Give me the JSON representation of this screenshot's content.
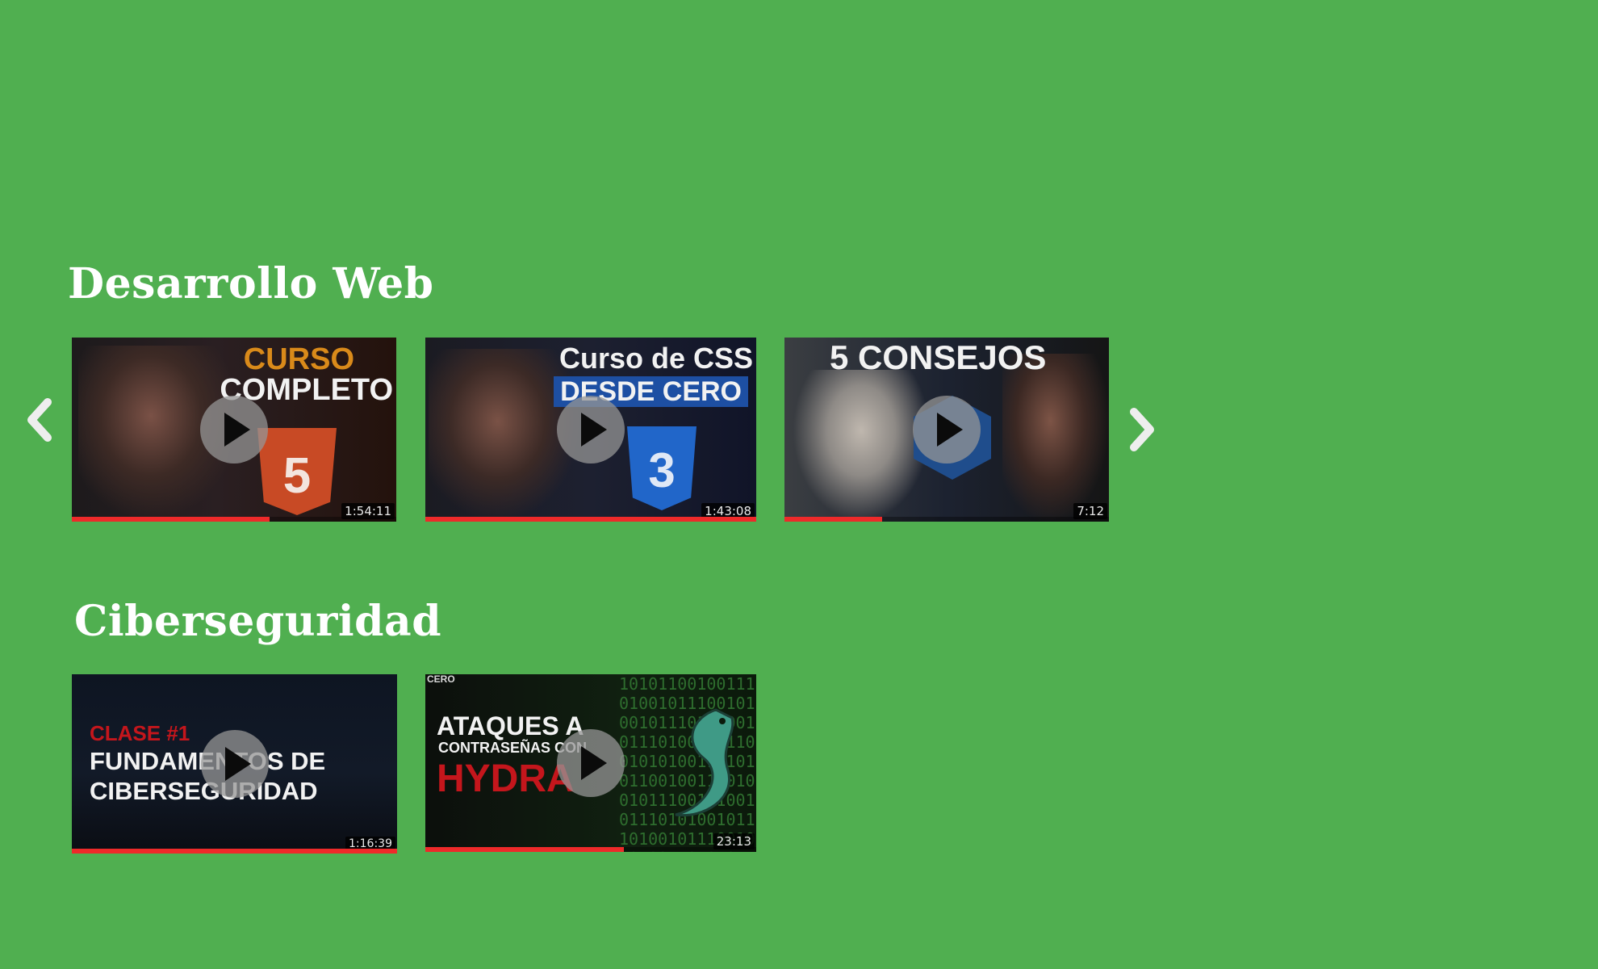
{
  "sections": [
    {
      "title": "Desarrollo Web",
      "videos": [
        {
          "line1": "CURSO",
          "line2": "COMPLETO",
          "duration": "1:54:11",
          "progress": 0.61,
          "icon": "html5-logo-icon"
        },
        {
          "line1": "Curso de CSS",
          "line2": "DESDE CERO",
          "duration": "1:43:08",
          "progress": 1.0,
          "icon": "css3-logo-icon"
        },
        {
          "line1": "5 CONSEJOS",
          "duration": "7:12",
          "progress": 0.3,
          "icon": "cpp-logo-icon"
        }
      ]
    },
    {
      "title": "Ciberseguridad",
      "videos": [
        {
          "line1": "CLASE #1",
          "line2": "FUNDAMENTOS DE",
          "line3": "CIBERSEGURIDAD",
          "duration": "1:16:39",
          "progress": 1.0
        },
        {
          "line1": "ATAQUES A",
          "line2": "CONTRASEÑAS CON",
          "line3": "HYDRA",
          "corner": "CERO",
          "duration": "23:13",
          "progress": 0.6,
          "icon": "hydra-dragon-icon"
        }
      ]
    }
  ],
  "nav": {
    "prev_icon": "chevron-left-icon",
    "next_icon": "chevron-right-icon"
  },
  "colors": {
    "background": "#50af50",
    "progress": "#ee2a2a",
    "title": "#ffffff"
  }
}
